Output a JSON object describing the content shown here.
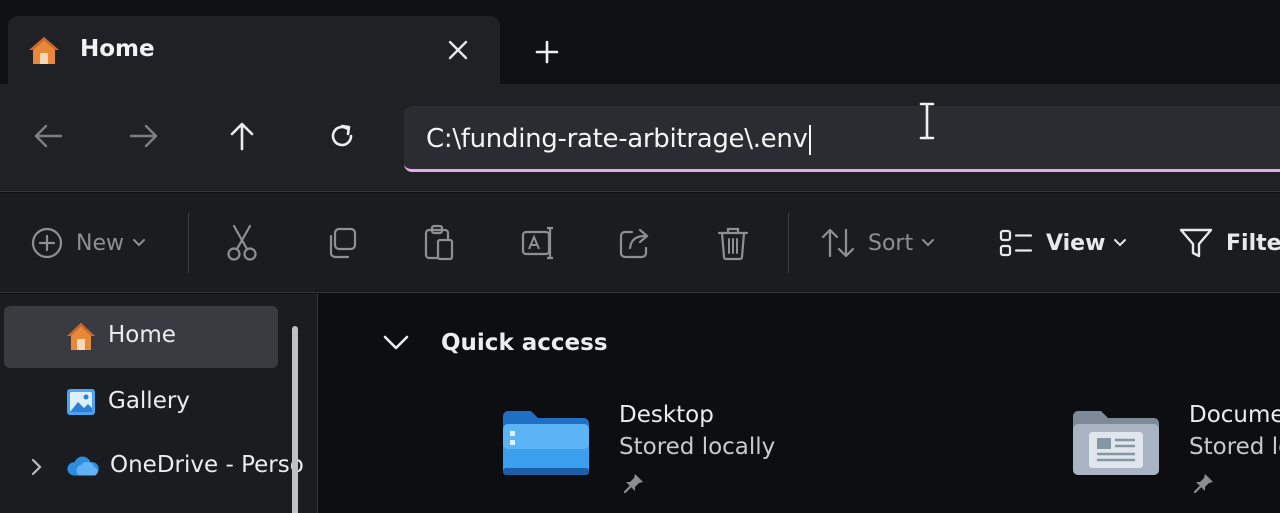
{
  "tab": {
    "title": "Home",
    "icon": "home-icon"
  },
  "address": {
    "path": "C:\\funding-rate-arbitrage\\.env"
  },
  "commands": {
    "new_label": "New",
    "sort_label": "Sort",
    "view_label": "View",
    "filter_label": "Filter"
  },
  "sidebar": {
    "items": [
      {
        "label": "Home",
        "icon": "home-icon",
        "selected": true
      },
      {
        "label": "Gallery",
        "icon": "gallery-icon"
      },
      {
        "label": "OneDrive - Perso",
        "icon": "onedrive-cloud-icon"
      }
    ]
  },
  "main": {
    "section_title": "Quick access",
    "folders": [
      {
        "name": "Desktop",
        "status": "Stored locally",
        "icon": "desktop-folder-icon"
      },
      {
        "name": "Documen",
        "status": "Stored lo",
        "icon": "documents-folder-icon"
      }
    ]
  },
  "colors": {
    "accent_underline": "#e6a8ec",
    "folder_blue": "#2f8de0",
    "home_orange": "#e8893a"
  }
}
